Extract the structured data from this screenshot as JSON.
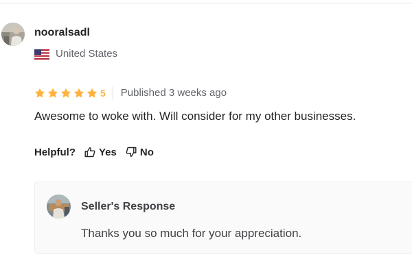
{
  "review": {
    "username": "nooralsadl",
    "country": "United States",
    "rating": "5",
    "star_count": 5,
    "star_color": "#ffb33e",
    "published": "Published 3 weeks ago",
    "text": "Awesome to woke with. Will consider for my other businesses."
  },
  "helpful": {
    "label": "Helpful?",
    "yes_label": "Yes",
    "no_label": "No"
  },
  "seller_response": {
    "title": "Seller's Response",
    "text": "Thanks you so much for your appreciation."
  },
  "icons": {
    "user_avatar": "user-avatar",
    "flag": "us-flag-icon",
    "star": "star-icon",
    "thumbs_up": "thumbs-up-icon",
    "thumbs_down": "thumbs-down-icon",
    "seller_avatar": "seller-avatar"
  }
}
